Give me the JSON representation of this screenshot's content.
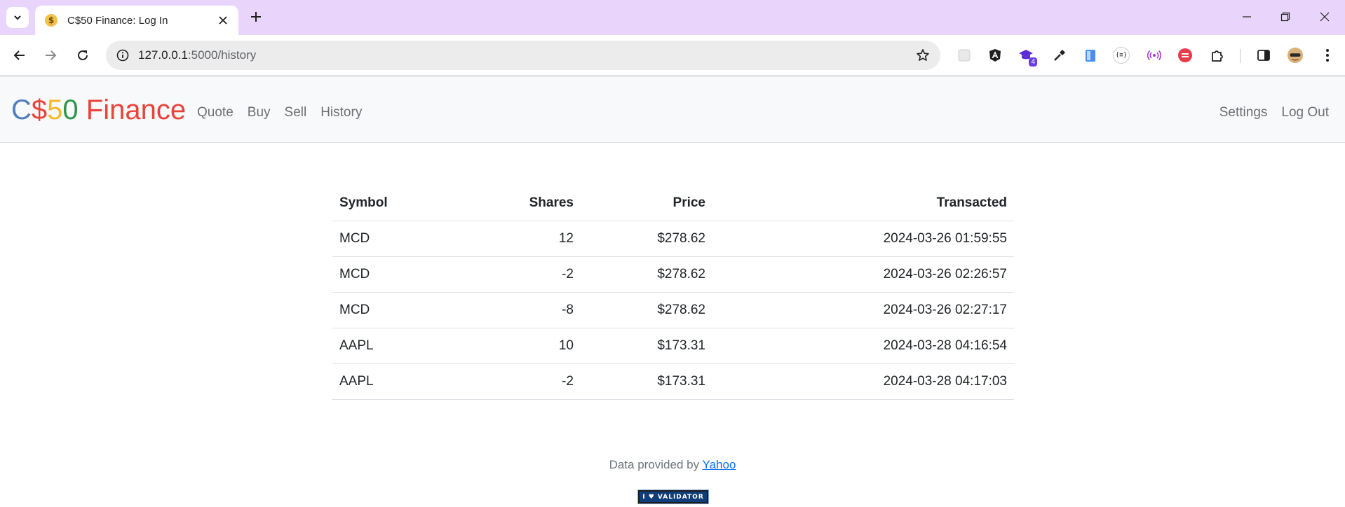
{
  "browser": {
    "tab_title": "C$50 Finance: Log In",
    "tab_favicon": "$",
    "url_host": "127.0.0.1",
    "url_path": ":5000/history",
    "extension_badge": "4",
    "extension_label": "{≡}"
  },
  "navbar": {
    "brand": {
      "part1": "C",
      "part2": "$",
      "part3": "5",
      "part4": "0",
      "part5": " Finance"
    },
    "links_left": [
      "Quote",
      "Buy",
      "Sell",
      "History"
    ],
    "links_right": [
      "Settings",
      "Log Out"
    ]
  },
  "table": {
    "headers": [
      "Symbol",
      "Shares",
      "Price",
      "Transacted"
    ],
    "rows": [
      [
        "MCD",
        "12",
        "$278.62",
        "2024-03-26 01:59:55"
      ],
      [
        "MCD",
        "-2",
        "$278.62",
        "2024-03-26 02:26:57"
      ],
      [
        "MCD",
        "-8",
        "$278.62",
        "2024-03-26 02:27:17"
      ],
      [
        "AAPL",
        "10",
        "$173.31",
        "2024-03-28 04:16:54"
      ],
      [
        "AAPL",
        "-2",
        "$173.31",
        "2024-03-28 04:17:03"
      ]
    ]
  },
  "footer": {
    "text": "Data provided by ",
    "link": "Yahoo",
    "validator_badge": "I ♥ VALIDATOR"
  }
}
